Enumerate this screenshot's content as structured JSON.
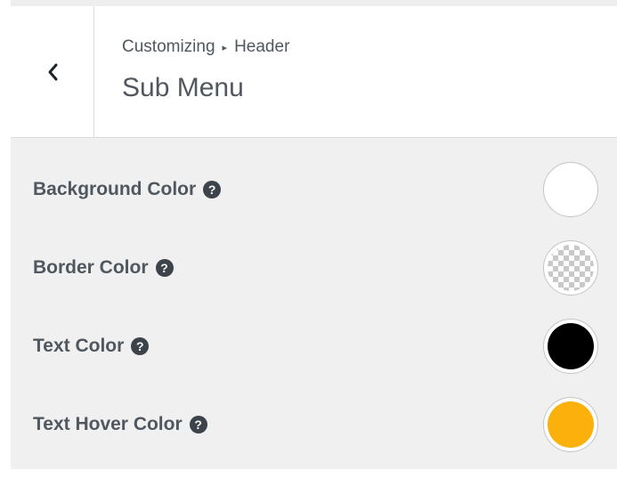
{
  "header": {
    "breadcrumb": {
      "parent": "Customizing",
      "separator": "▸",
      "current": "Header"
    },
    "title": "Sub Menu",
    "back_icon": "chevron-left-icon"
  },
  "settings": [
    {
      "label": "Background Color",
      "help_glyph": "?",
      "color": "#ffffff",
      "transparent": false
    },
    {
      "label": "Border Color",
      "help_glyph": "?",
      "color": "transparent",
      "transparent": true
    },
    {
      "label": "Text Color",
      "help_glyph": "?",
      "color": "#000000",
      "transparent": false
    },
    {
      "label": "Text Hover Color",
      "help_glyph": "?",
      "color": "#fcb00b",
      "transparent": false
    }
  ],
  "colors": {
    "panel_background": "#f0f0f1",
    "text": "#50575e",
    "help_icon": "#3c434a"
  }
}
